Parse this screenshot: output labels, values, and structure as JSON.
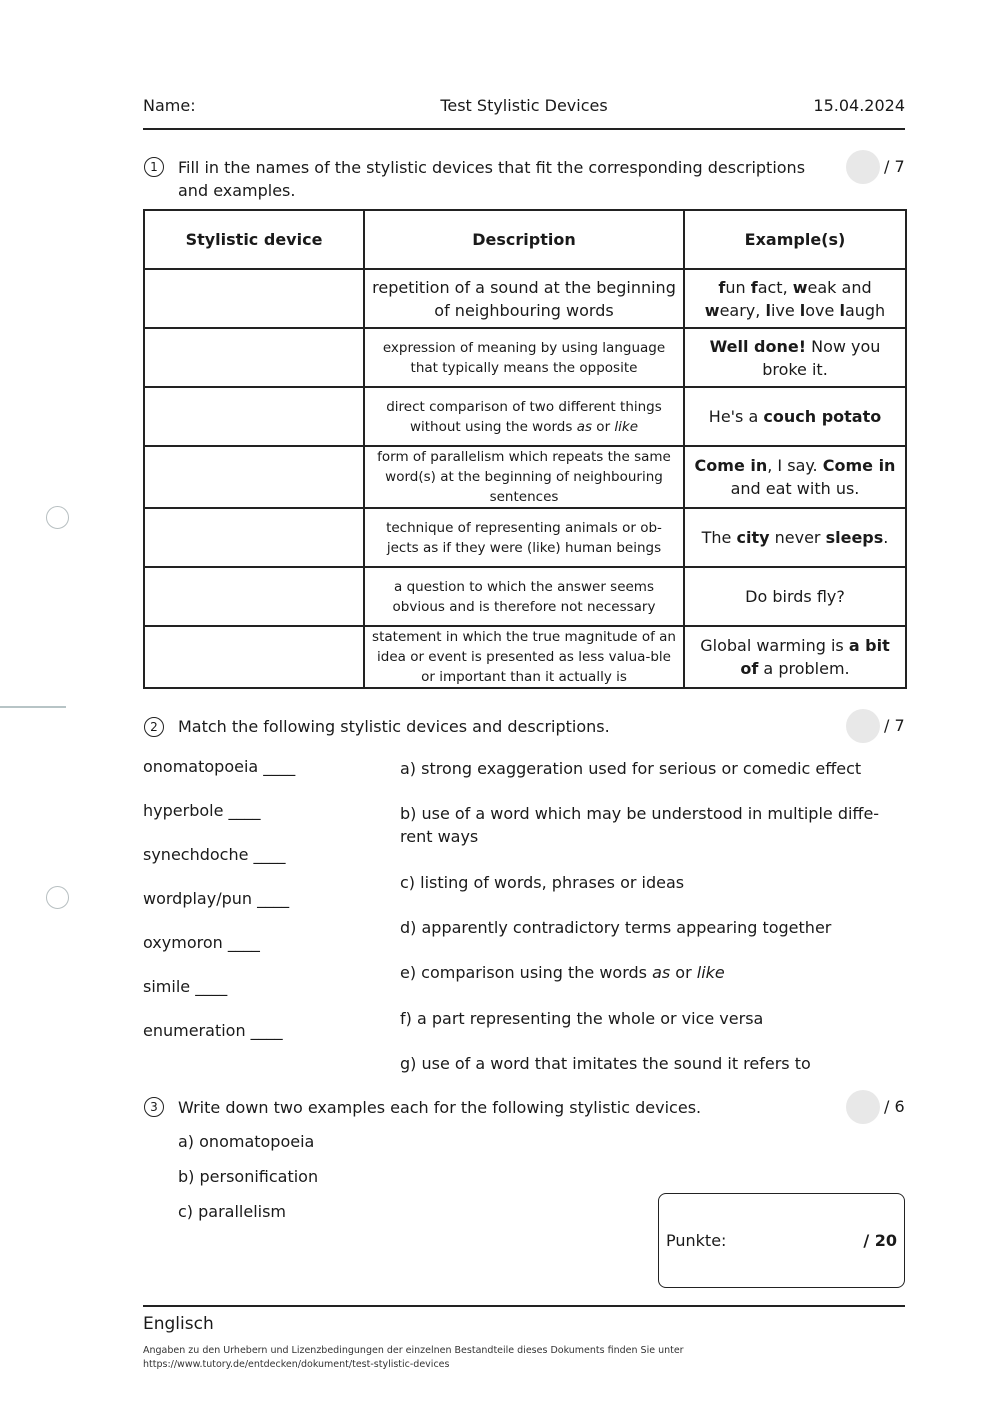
{
  "header": {
    "name_label": "Name:",
    "title": "Test Stylistic Devices",
    "date": "15.04.2024"
  },
  "task1": {
    "number": "1",
    "instruction_line1": "Fill in the names of the stylistic devices that fit the corresponding descriptions",
    "instruction_line2": "and examples.",
    "max_score": "/ 7",
    "table": {
      "headers": [
        "Stylistic device",
        "Description",
        "Example(s)"
      ],
      "rows": [
        {
          "device": "",
          "description": "repetition of a sound at the beginning of neighbouring words",
          "example_html": "<b>f</b>un <b>f</b>act, <b>w</b>eak and <b>w</b>eary, <b>l</b>ive <b>l</b>ove <b>l</b>augh",
          "desc_size": "large"
        },
        {
          "device": "",
          "description": "expression of meaning by using language that typically means the opposite",
          "example_html": "<b>Well done!</b> Now you broke it.",
          "desc_size": "small"
        },
        {
          "device": "",
          "description_html": "direct comparison of two different things without using the words <i>as</i> or <i>like</i>",
          "example_html": "He's a <b>couch potato</b>",
          "desc_size": "small"
        },
        {
          "device": "",
          "description": "form of parallelism which repeats the same word(s) at the beginning of neighbouring sentences",
          "example_html": "<b>Come in</b>, I say. <b>Come in</b> and eat with us.",
          "desc_size": "small"
        },
        {
          "device": "",
          "description": "technique of representing animals or ob-jects as if they were (like) human beings",
          "example_html": "The <b>city</b> never <b>sleeps</b>.",
          "desc_size": "small"
        },
        {
          "device": "",
          "description": "a question to which the answer seems obvious and is therefore not necessary",
          "example_html": "Do birds fly?",
          "desc_size": "small"
        },
        {
          "device": "",
          "description": "statement in which the true magnitude of an idea or event is presented as less valua-ble or important than it actually is",
          "example_html": "Global warming is <b>a bit of</b> a problem.",
          "desc_size": "small"
        }
      ]
    }
  },
  "task2": {
    "number": "2",
    "instruction": "Match the following stylistic devices and descriptions.",
    "max_score": "/ 7",
    "devices": [
      "onomatopoeia ____",
      "hyperbole ____",
      "synechdoche ____",
      "wordplay/pun ____",
      "oxymoron ____",
      "simile ____",
      "enumeration ____"
    ],
    "descriptions": [
      {
        "html": "a) strong exaggeration used for serious or comedic effect"
      },
      {
        "html": "b) use of a word which may be understood in multiple diffe-<br>rent ways"
      },
      {
        "html": "c) listing of words, phrases or ideas"
      },
      {
        "html": "d) apparently contradictory terms appearing together"
      },
      {
        "html": "e) comparison using the words <i>as</i> or <i>like</i>"
      },
      {
        "html": "f) a part representing the whole or vice versa"
      },
      {
        "html": "g) use of a word that imitates the sound it refers to"
      }
    ]
  },
  "task3": {
    "number": "3",
    "instruction": "Write down two examples each for the following stylistic devices.",
    "max_score": "/ 6",
    "items": [
      "a) onomatopoeia",
      "b) personification",
      "c) parallelism"
    ]
  },
  "points_box": {
    "label": "Punkte:",
    "total": "/ 20"
  },
  "footer": {
    "subject": "Englisch",
    "note_line1": "Angaben zu den Urhebern und Lizenzbedingungen der einzelnen Bestandteile dieses Dokuments finden Sie unter",
    "note_line2": "https://www.tutory.de/entdecken/dokument/test-stylistic-devices"
  }
}
